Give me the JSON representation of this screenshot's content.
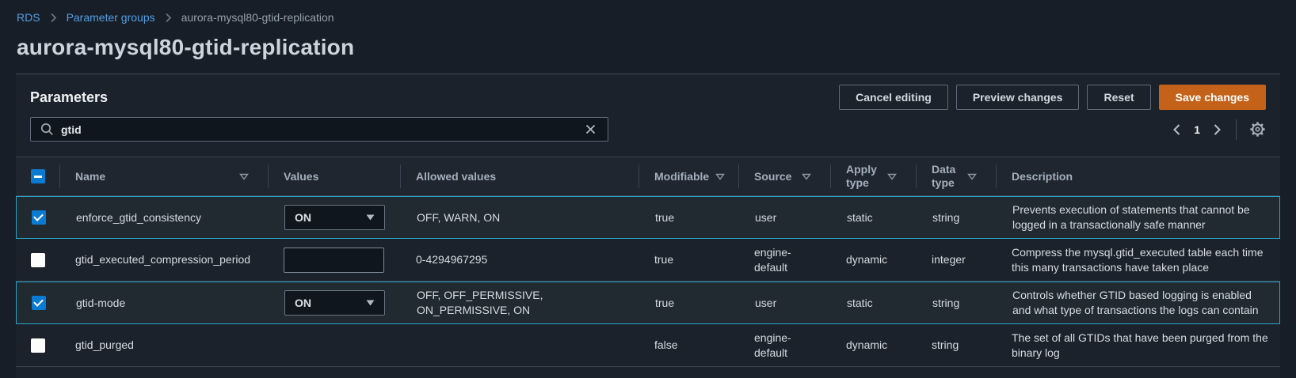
{
  "breadcrumb": {
    "items": [
      {
        "label": "RDS"
      },
      {
        "label": "Parameter groups"
      },
      {
        "label": "aurora-mysql80-gtid-replication"
      }
    ]
  },
  "page_title": "aurora-mysql80-gtid-replication",
  "panel": {
    "title": "Parameters",
    "actions": {
      "cancel": "Cancel editing",
      "preview": "Preview changes",
      "reset": "Reset",
      "save": "Save changes"
    },
    "search": {
      "value": "gtid",
      "icon": "magnifier-icon",
      "clear_icon": "x-icon"
    },
    "pagination": {
      "page": "1",
      "prev_icon": "chevron-left",
      "next_icon": "chevron-right",
      "settings_icon": "gear-icon"
    }
  },
  "table": {
    "headers": {
      "name": "Name",
      "values": "Values",
      "allowed_values": "Allowed values",
      "modifiable": "Modifiable",
      "source": "Source",
      "apply_type": "Apply type",
      "data_type": "Data type",
      "description": "Description"
    },
    "rows": [
      {
        "checked": true,
        "selected": true,
        "name": "enforce_gtid_consistency",
        "value_type": "select",
        "value": "ON",
        "allowed_values": "OFF, WARN, ON",
        "modifiable": "true",
        "source": "user",
        "apply_type": "static",
        "data_type": "string",
        "description": "Prevents execution of statements that cannot be logged in a transactionally safe manner"
      },
      {
        "checked": false,
        "selected": false,
        "name": "gtid_executed_compression_period",
        "value_type": "input",
        "value": "",
        "allowed_values": "0-4294967295",
        "modifiable": "true",
        "source": "engine-default",
        "apply_type": "dynamic",
        "data_type": "integer",
        "description": "Compress the mysql.gtid_executed table each time this many transactions have taken place"
      },
      {
        "checked": true,
        "selected": true,
        "name": "gtid-mode",
        "value_type": "select",
        "value": "ON",
        "allowed_values": "OFF, OFF_PERMISSIVE, ON_PERMISSIVE, ON",
        "modifiable": "true",
        "source": "user",
        "apply_type": "static",
        "data_type": "string",
        "description": "Controls whether GTID based logging is enabled and what type of transactions the logs can contain"
      },
      {
        "checked": false,
        "selected": false,
        "name": "gtid_purged",
        "value_type": "none",
        "value": "",
        "allowed_values": "",
        "modifiable": "false",
        "source": "engine-default",
        "apply_type": "dynamic",
        "data_type": "string",
        "description": "The set of all GTIDs that have been purged from the binary log"
      }
    ]
  },
  "colors": {
    "accent_orange": "#c4621a",
    "link_blue": "#539fe5",
    "selected_row_border": "#2ba3c7",
    "checkbox_blue": "#0b7bd1"
  }
}
